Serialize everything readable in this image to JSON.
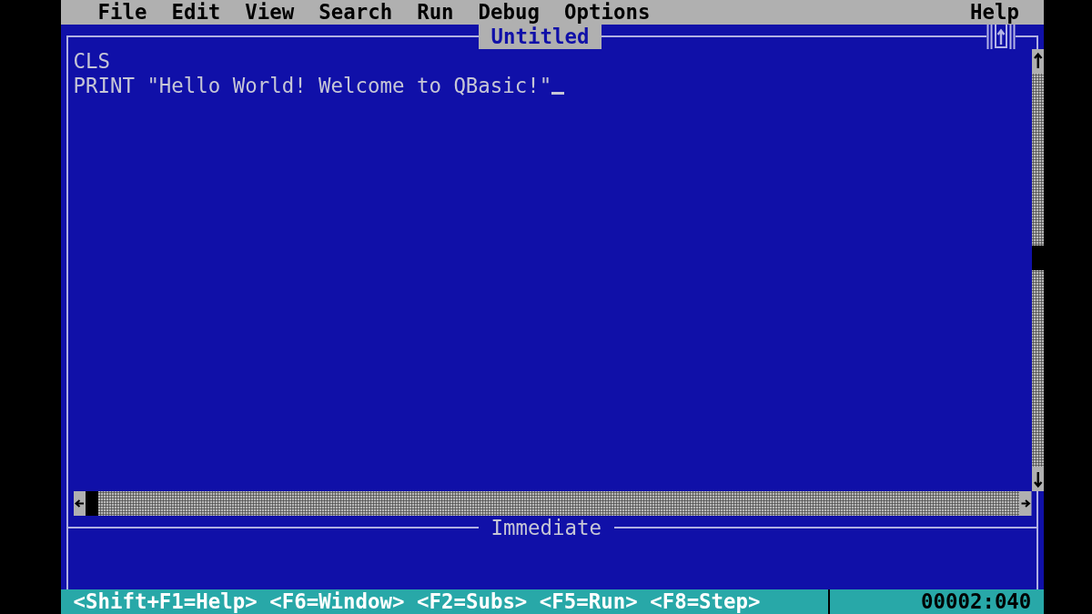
{
  "menu_bar": {
    "items": [
      "File",
      "Edit",
      "View",
      "Search",
      "Run",
      "Debug",
      "Options"
    ],
    "help": "Help"
  },
  "editor": {
    "title": "Untitled",
    "lines": [
      {
        "text": "CLS",
        "cursor": false
      },
      {
        "text": "PRINT \"Hello World! Welcome to QBasic!\"",
        "cursor": true
      }
    ]
  },
  "immediate": {
    "title": "Immediate"
  },
  "status_bar": {
    "hints": [
      "<Shift+F1=Help>",
      "<F6=Window>",
      "<F2=Subs>",
      "<F5=Run>",
      "<F8=Step>"
    ],
    "position": "00002:040"
  }
}
